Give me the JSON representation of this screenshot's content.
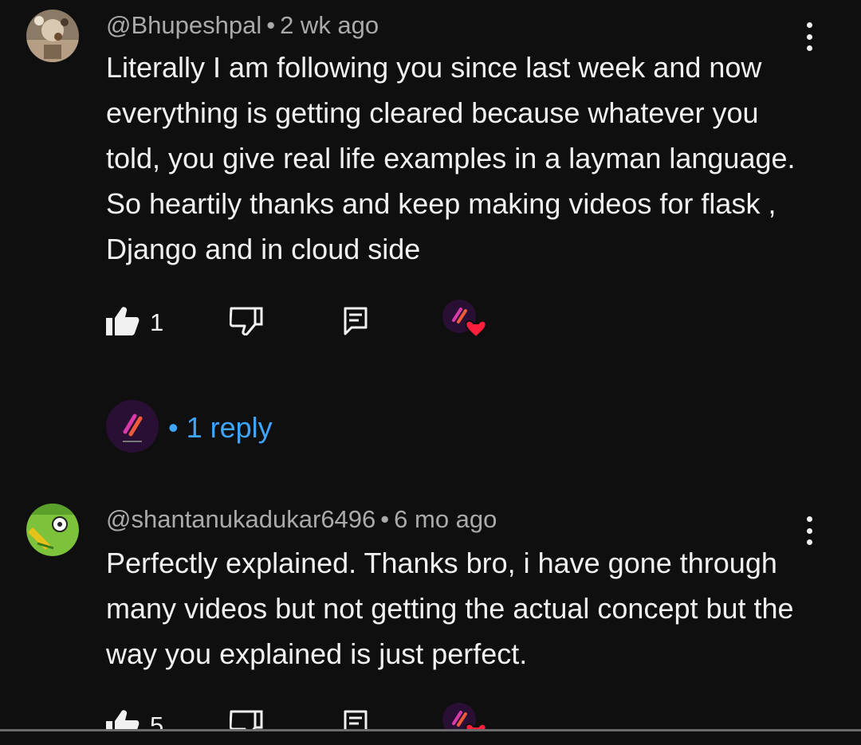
{
  "comments": [
    {
      "author": "@Bhupeshpal",
      "time": "2 wk ago",
      "text": "Literally I am following you since last week and now everything is getting cleared because whatever you told, you give real  life examples in a layman language. So heartily thanks and keep making videos for flask , Django and in cloud side",
      "likes": "1",
      "replies_label": "1 reply"
    },
    {
      "author": "@shantanukadukar6496",
      "time": "6 mo ago",
      "text": "Perfectly explained. Thanks bro, i have gone through many videos but not getting the actual concept but the way you explained is just perfect.",
      "likes": "5"
    }
  ],
  "meta_separator": "•",
  "colors": {
    "background": "#0f0f0f",
    "text": "#f1f1f1",
    "meta": "#aaaaaa",
    "link": "#3ea6ff",
    "heart": "#ff1f3d",
    "creator_badge": "#2a0f35"
  },
  "icons": {
    "like": "thumb-up-filled-icon",
    "dislike": "thumb-down-outline-icon",
    "reply": "comment-icon",
    "more": "more-vertical-icon",
    "creator_heart": "creator-heart-icon"
  }
}
